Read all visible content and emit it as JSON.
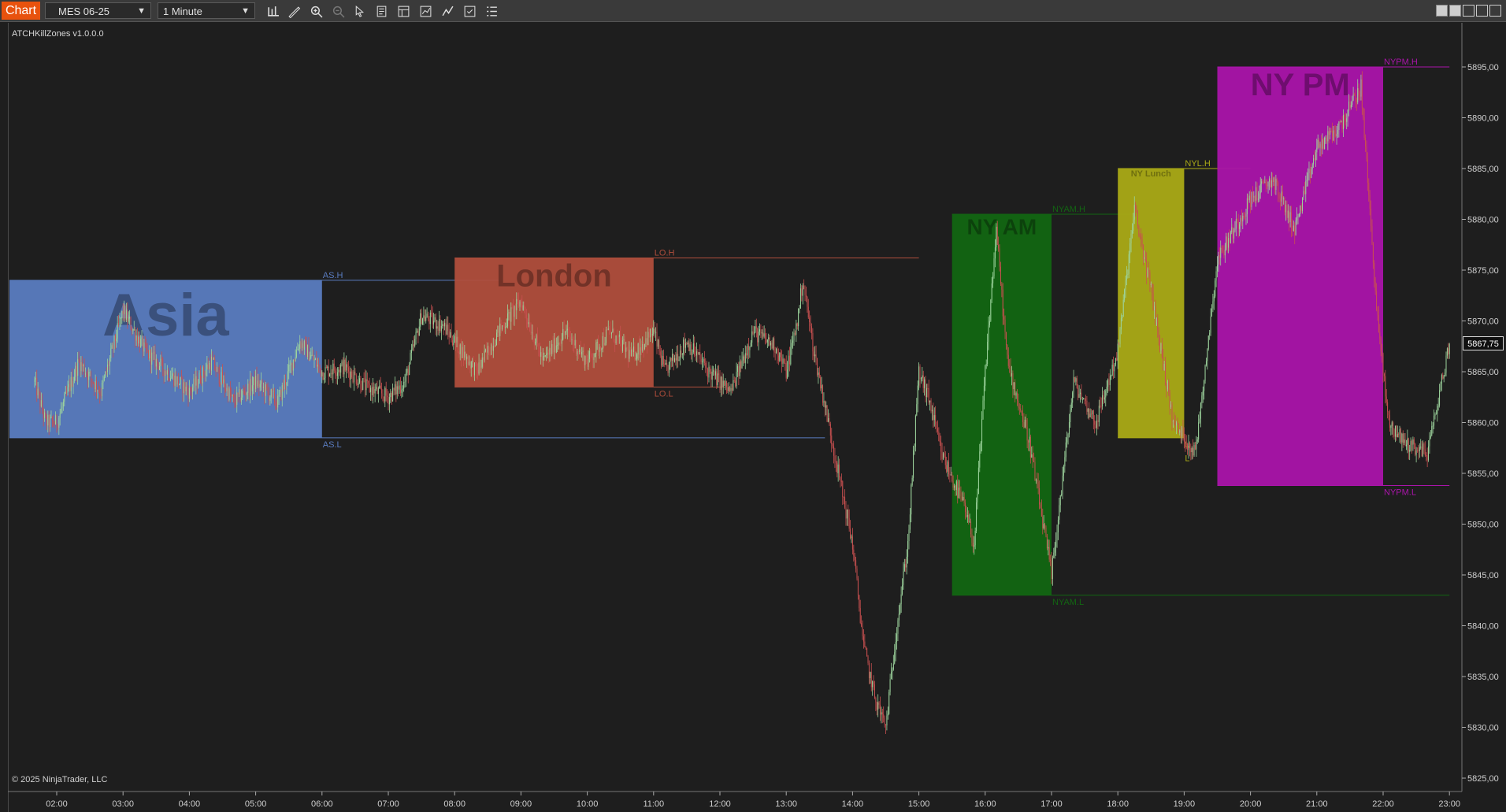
{
  "toolbar": {
    "chart_tab": "Chart",
    "instrument": "MES 06-25",
    "interval": "1 Minute",
    "tools": [
      "bar-type-icon",
      "draw-icon",
      "zoom-in-icon",
      "zoom-out-icon",
      "pointer-icon",
      "properties-icon",
      "templates-icon",
      "strategies-icon",
      "indicators-icon",
      "data-box-icon"
    ]
  },
  "indicator_label": "ATCHKillZones  v1.0.0.0",
  "copyright": "© 2025 NinjaTrader, LLC",
  "last_price": "5867,75",
  "colors": {
    "asia": "#5a7cc0",
    "london": "#b04e3c",
    "ny_am": "#126612",
    "ny_lunch": "#aaaa16",
    "ny_pm": "#aa14aa",
    "up_candle": "#9dd49d",
    "down_candle": "#c85050"
  },
  "price_axis": [
    "5895,00",
    "5890,00",
    "5885,00",
    "5880,00",
    "5875,00",
    "5870,00",
    "5865,00",
    "5860,00",
    "5855,00",
    "5850,00",
    "5845,00",
    "5840,00",
    "5835,00",
    "5830,00",
    "5825,00"
  ],
  "time_axis": [
    "02:00",
    "03:00",
    "04:00",
    "05:00",
    "06:00",
    "07:00",
    "08:00",
    "09:00",
    "10:00",
    "11:00",
    "12:00",
    "13:00",
    "14:00",
    "15:00",
    "16:00",
    "17:00",
    "18:00",
    "19:00",
    "20:00",
    "21:00",
    "22:00",
    "23:00"
  ],
  "chart_data": {
    "type": "candlestick",
    "symbol": "MES 06-25",
    "interval": "1 Minute",
    "x_range": [
      "01:38",
      "23:00"
    ],
    "ylim": [
      5824,
      5899
    ],
    "price_path": [
      [
        "01:40",
        5864.0
      ],
      [
        "01:50",
        5860.0
      ],
      [
        "02:00",
        5860.0
      ],
      [
        "02:20",
        5866.0
      ],
      [
        "02:40",
        5863.0
      ],
      [
        "03:00",
        5871.0
      ],
      [
        "03:20",
        5867.0
      ],
      [
        "03:40",
        5865.0
      ],
      [
        "04:00",
        5863.0
      ],
      [
        "04:20",
        5866.0
      ],
      [
        "04:40",
        5862.0
      ],
      [
        "05:00",
        5864.0
      ],
      [
        "05:20",
        5862.0
      ],
      [
        "05:40",
        5868.0
      ],
      [
        "06:00",
        5865.0
      ],
      [
        "06:20",
        5865.5
      ],
      [
        "06:40",
        5863.5
      ],
      [
        "07:00",
        5862.5
      ],
      [
        "07:15",
        5864.0
      ],
      [
        "07:30",
        5870.5
      ],
      [
        "07:50",
        5869.5
      ],
      [
        "08:00",
        5868.0
      ],
      [
        "08:20",
        5865.0
      ],
      [
        "08:40",
        5869.0
      ],
      [
        "09:00",
        5872.0
      ],
      [
        "09:20",
        5866.0
      ],
      [
        "09:40",
        5869.0
      ],
      [
        "10:00",
        5866.0
      ],
      [
        "10:20",
        5869.0
      ],
      [
        "10:40",
        5866.5
      ],
      [
        "11:00",
        5869.0
      ],
      [
        "11:10",
        5865.0
      ],
      [
        "11:30",
        5868.0
      ],
      [
        "11:50",
        5865.0
      ],
      [
        "12:10",
        5863.0
      ],
      [
        "12:30",
        5869.0
      ],
      [
        "12:50",
        5867.5
      ],
      [
        "13:00",
        5865.0
      ],
      [
        "13:10",
        5870.0
      ],
      [
        "13:15",
        5874.0
      ],
      [
        "13:25",
        5867.0
      ],
      [
        "13:40",
        5859.0
      ],
      [
        "14:00",
        5848.0
      ],
      [
        "14:10",
        5838.0
      ],
      [
        "14:20",
        5833.0
      ],
      [
        "14:30",
        5830.0
      ],
      [
        "14:40",
        5840.0
      ],
      [
        "14:50",
        5848.0
      ],
      [
        "15:00",
        5865.0
      ],
      [
        "15:10",
        5862.0
      ],
      [
        "15:20",
        5857.0
      ],
      [
        "15:40",
        5852.0
      ],
      [
        "15:50",
        5848.0
      ],
      [
        "16:00",
        5865.0
      ],
      [
        "16:10",
        5879.0
      ],
      [
        "16:20",
        5866.0
      ],
      [
        "16:40",
        5858.0
      ],
      [
        "17:00",
        5845.0
      ],
      [
        "17:20",
        5864.0
      ],
      [
        "17:40",
        5860.0
      ],
      [
        "18:00",
        5867.0
      ],
      [
        "18:15",
        5881.0
      ],
      [
        "18:30",
        5873.0
      ],
      [
        "18:50",
        5860.0
      ],
      [
        "19:10",
        5857.0
      ],
      [
        "19:30",
        5876.0
      ],
      [
        "20:00",
        5882.0
      ],
      [
        "20:20",
        5884.0
      ],
      [
        "20:40",
        5879.0
      ],
      [
        "21:00",
        5887.0
      ],
      [
        "21:20",
        5889.0
      ],
      [
        "21:40",
        5893.0
      ],
      [
        "21:55",
        5870.0
      ],
      [
        "22:05",
        5860.0
      ],
      [
        "22:20",
        5858.0
      ],
      [
        "22:40",
        5857.0
      ],
      [
        "23:00",
        5867.75
      ]
    ],
    "sessions": [
      {
        "label": "Asia",
        "start": "01:00",
        "end": "06:00",
        "high": 5874.0,
        "low": 5858.5,
        "high_label": "AS.H",
        "low_label": "AS.L",
        "extend_high_to": "08:40",
        "extend_low_to": "13:35"
      },
      {
        "label": "London",
        "start": "08:00",
        "end": "11:00",
        "high": 5876.2,
        "low": 5863.5,
        "high_label": "LO.H",
        "low_label": "LO.L",
        "extend_high_to": "15:00",
        "extend_low_to": "12:05"
      },
      {
        "label": "NY AM",
        "start": "15:30",
        "end": "17:00",
        "high": 5880.5,
        "low": 5843.0,
        "high_label": "NYAM.H",
        "low_label": "NYAM.L",
        "extend_high_to": "18:15",
        "extend_low_to": "23:00"
      },
      {
        "label": "NY Lunch",
        "start": "18:00",
        "end": "19:00",
        "high": 5885.0,
        "low": 5858.5,
        "high_label": "NYL.H",
        "low_label": "L",
        "extend_high_to": "20:00",
        "extend_low_to": "19:00"
      },
      {
        "label": "NY PM",
        "start": "19:30",
        "end": "22:00",
        "high": 5895.0,
        "low": 5853.8,
        "high_label": "NYPM.H",
        "low_label": "NYPM.L",
        "extend_high_to": "23:00",
        "extend_low_to": "23:00"
      }
    ],
    "extra_labels": [
      {
        "text": "L",
        "time": "19:00",
        "price": 5856.2
      }
    ]
  }
}
